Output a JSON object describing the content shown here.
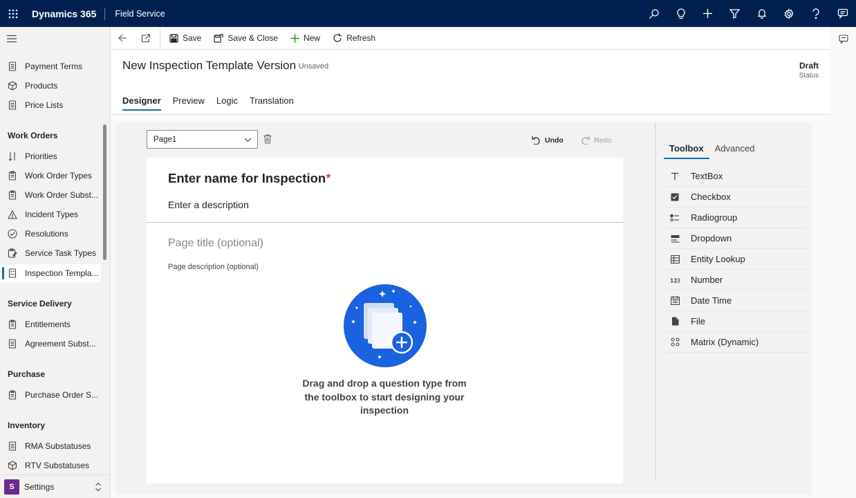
{
  "topbar": {
    "app_name": "Dynamics 365",
    "area_name": "Field Service",
    "icons": [
      "search-icon",
      "lightbulb-icon",
      "add-icon",
      "filter-icon",
      "bell-icon",
      "gear-icon",
      "help-icon",
      "chat-icon"
    ]
  },
  "sidebar": {
    "items_top": [
      {
        "label": "Payment Terms",
        "icon": "document-icon"
      },
      {
        "label": "Products",
        "icon": "box-icon"
      },
      {
        "label": "Price Lists",
        "icon": "document-icon"
      }
    ],
    "groups": [
      {
        "title": "Work Orders",
        "items": [
          {
            "label": "Priorities",
            "icon": "sort-icon"
          },
          {
            "label": "Work Order Types",
            "icon": "clipboard-icon"
          },
          {
            "label": "Work Order Subst...",
            "icon": "clipboard-icon"
          },
          {
            "label": "Incident Types",
            "icon": "warning-icon"
          },
          {
            "label": "Resolutions",
            "icon": "check-circle-icon"
          },
          {
            "label": "Service Task Types",
            "icon": "task-icon"
          },
          {
            "label": "Inspection Templa...",
            "icon": "checklist-icon"
          }
        ]
      },
      {
        "title": "Service Delivery",
        "items": [
          {
            "label": "Entitlements",
            "icon": "clipboard-icon"
          },
          {
            "label": "Agreement Subst...",
            "icon": "document-icon"
          }
        ]
      },
      {
        "title": "Purchase",
        "items": [
          {
            "label": "Purchase Order S...",
            "icon": "clipboard-icon"
          }
        ]
      },
      {
        "title": "Inventory",
        "items": [
          {
            "label": "RMA Substatuses",
            "icon": "document-icon"
          },
          {
            "label": "RTV Substatuses",
            "icon": "box-icon"
          }
        ]
      }
    ],
    "area_switcher": {
      "badge": "S",
      "label": "Settings"
    }
  },
  "commandbar": {
    "save": "Save",
    "save_close": "Save & Close",
    "new": "New",
    "refresh": "Refresh"
  },
  "header": {
    "title": "New Inspection Template Version",
    "unsaved": "- Unsaved",
    "status_value": "Draft",
    "status_label": "Status",
    "tabs": [
      "Designer",
      "Preview",
      "Logic",
      "Translation"
    ]
  },
  "designer": {
    "page_select": "Page1",
    "undo": "Undo",
    "redo": "Redo",
    "inspection_name": "Enter name for Inspection",
    "required_mark": "*",
    "inspection_description": "Enter a description",
    "page_title_placeholder": "Page title (optional)",
    "page_description_placeholder": "Page description (optional)",
    "empty_message": "Drag and drop a question type from the toolbox to start designing your inspection"
  },
  "toolbox": {
    "tabs": [
      "Toolbox",
      "Advanced"
    ],
    "items": [
      {
        "label": "TextBox",
        "icon": "text-icon"
      },
      {
        "label": "Checkbox",
        "icon": "checkbox-icon"
      },
      {
        "label": "Radiogroup",
        "icon": "radiogroup-icon"
      },
      {
        "label": "Dropdown",
        "icon": "dropdown-icon"
      },
      {
        "label": "Entity Lookup",
        "icon": "table-icon"
      },
      {
        "label": "Number",
        "icon": "number-icon"
      },
      {
        "label": "Date Time",
        "icon": "calendar-icon"
      },
      {
        "label": "File",
        "icon": "file-icon"
      },
      {
        "label": "Matrix (Dynamic)",
        "icon": "matrix-icon"
      }
    ]
  },
  "colors": {
    "topbar": "#002050",
    "accent": "#0f6cbd",
    "required": "#c50f1f",
    "illustration": "#1a62e0"
  }
}
